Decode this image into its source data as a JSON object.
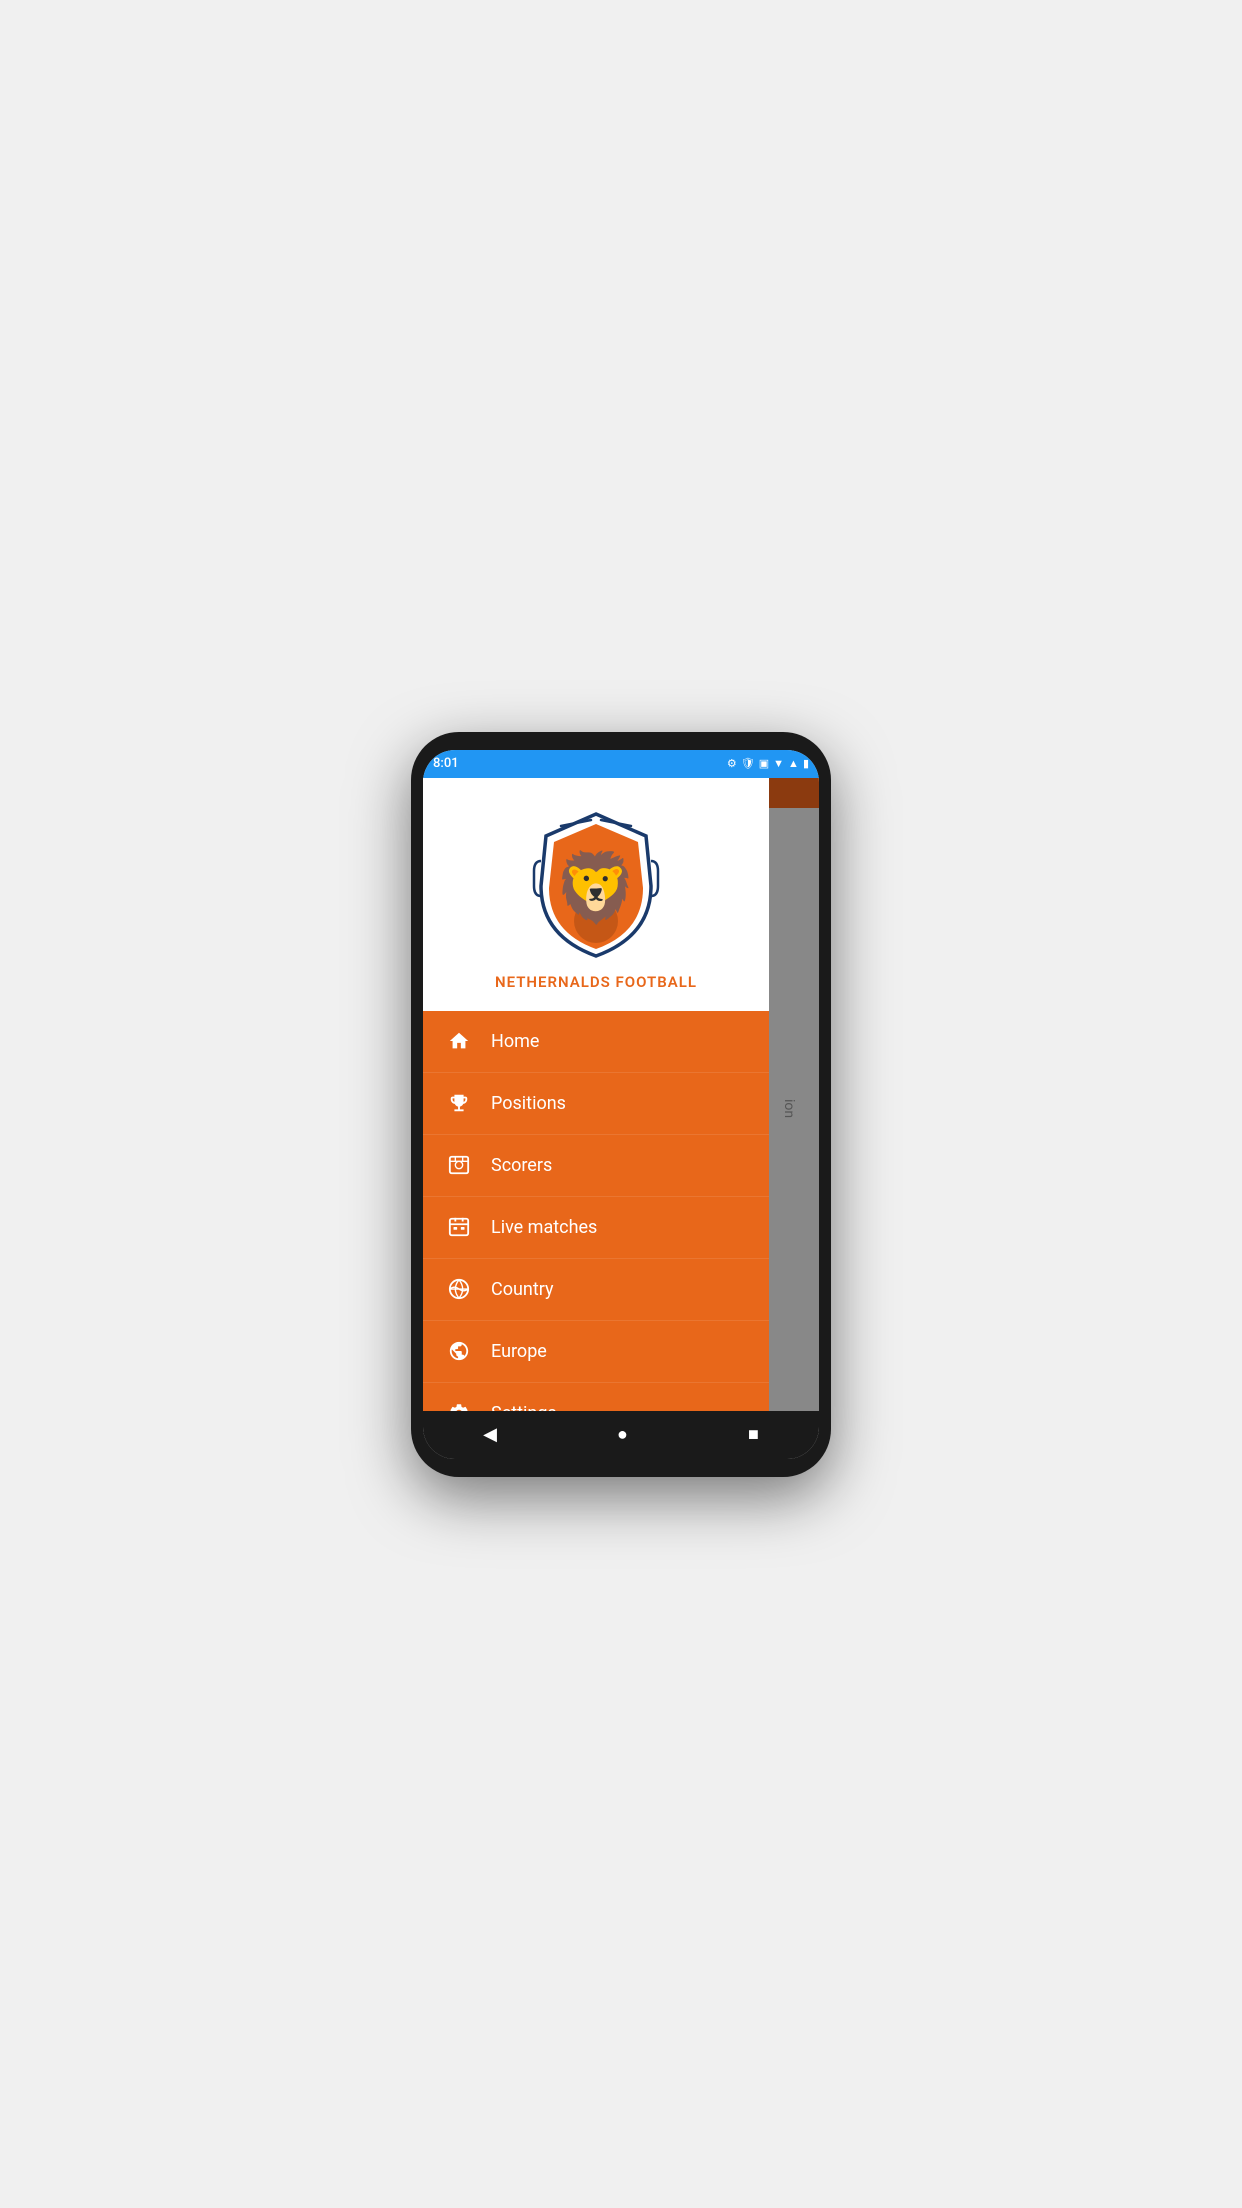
{
  "statusBar": {
    "time": "8:01",
    "icons": [
      "⚙",
      "🛡",
      "🔋"
    ]
  },
  "header": {
    "appTitle": "NETHERNALDS FOOTBALL"
  },
  "backgroundPeek": {
    "text": "ion"
  },
  "navItems": [
    {
      "id": "home",
      "label": "Home",
      "icon": "home"
    },
    {
      "id": "positions",
      "label": "Positions",
      "icon": "trophy"
    },
    {
      "id": "scorers",
      "label": "Scorers",
      "icon": "scorers"
    },
    {
      "id": "live-matches",
      "label": "Live matches",
      "icon": "calendar"
    },
    {
      "id": "country",
      "label": "Country",
      "icon": "globe"
    },
    {
      "id": "europe",
      "label": "Europe",
      "icon": "europe"
    },
    {
      "id": "settings",
      "label": "Settings",
      "icon": "settings"
    }
  ],
  "bottomNav": {
    "back": "◀",
    "home": "●",
    "recent": "■"
  }
}
